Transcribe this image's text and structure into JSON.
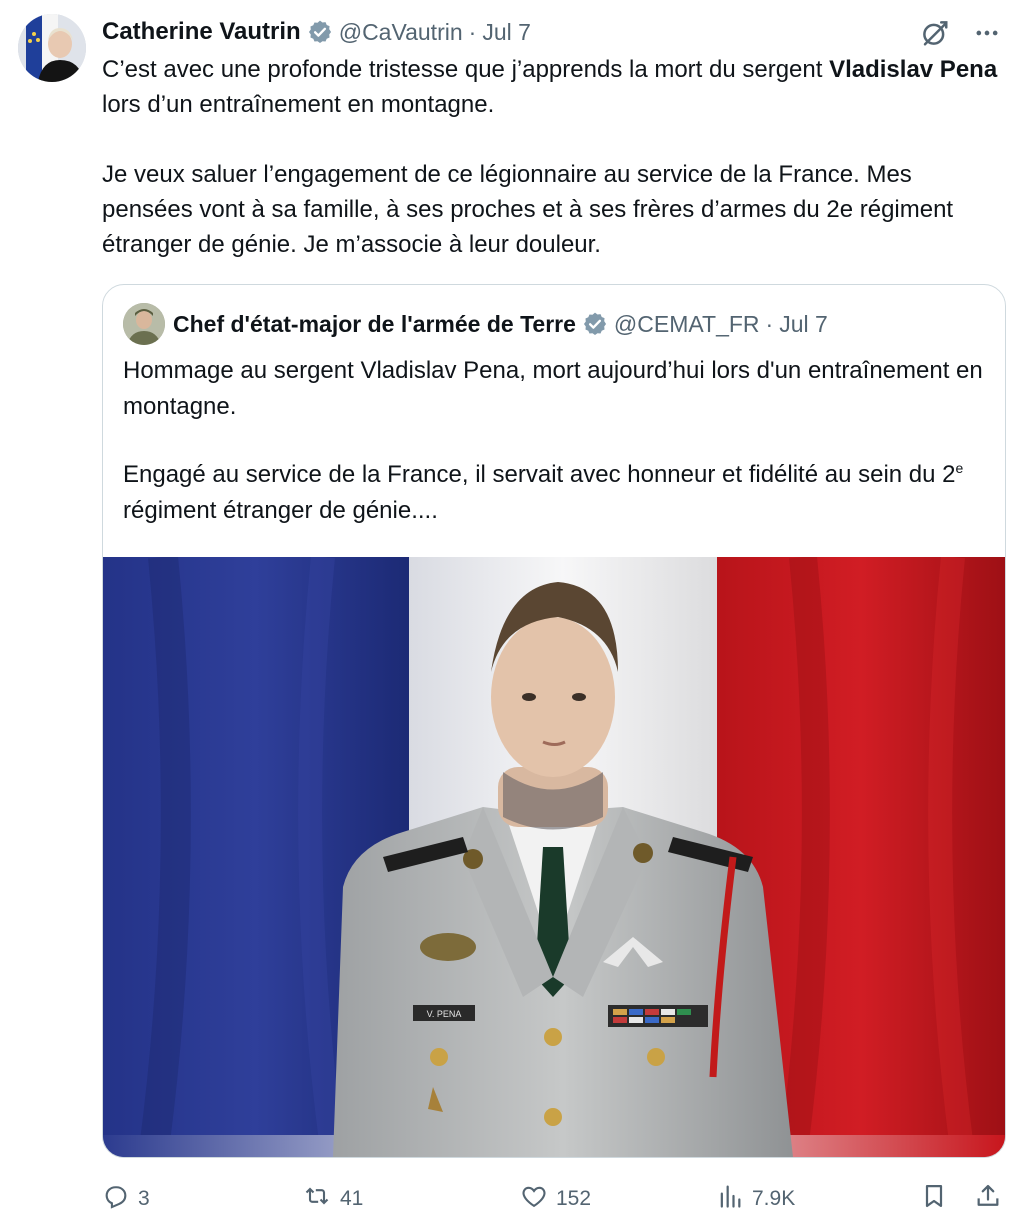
{
  "tweet": {
    "author_name": "Catherine Vautrin",
    "handle": "@CaVautrin",
    "separator": "·",
    "date": "Jul 7",
    "text_line1_part1": "C’est avec une profonde tristesse que j’apprends la mort du sergent ",
    "text_line1_bold": "Vladislav Pena",
    "text_line1_part2": " lors d’un entraînement en montagne.",
    "text_paragraph2": "Je veux saluer l’engagement de ce légionnaire au service de la France. Mes pensées vont à sa famille, à ses proches et à ses frères d’armes du 2e régiment étranger de génie. Je m’associe à leur douleur."
  },
  "quote": {
    "author_name": "Chef d'état-major de l'armée de Terre",
    "handle": "@CEMAT_FR",
    "separator": "·",
    "date": "Jul 7",
    "text_paragraph1": "Hommage au sergent Vladislav Pena, mort aujourd’hui lors d'un entraînement en montagne.",
    "text_paragraph2_part1": "Engagé au service de la France, il servait avec honneur et fidélité au sein du 2",
    "text_paragraph2_sup": "e",
    "text_paragraph2_part2": " régiment étranger de génie....",
    "image": {
      "name_tag": "V. PENA"
    }
  },
  "actions": {
    "replies": "3",
    "reposts": "41",
    "likes": "152",
    "views": "7.9K"
  },
  "colors": {
    "text_primary": "#0f1419",
    "text_secondary": "#536471",
    "verified_badge": "#829aab",
    "flag_blue": "#1f2f80",
    "flag_red": "#c0151d",
    "border": "#cfd9de"
  },
  "icons": {
    "verified": "verified-badge-icon",
    "grok": "grok-icon",
    "more": "more-icon",
    "reply": "reply-icon",
    "repost": "repost-icon",
    "like": "like-icon",
    "views": "views-icon",
    "bookmark": "bookmark-icon",
    "share": "share-icon"
  }
}
